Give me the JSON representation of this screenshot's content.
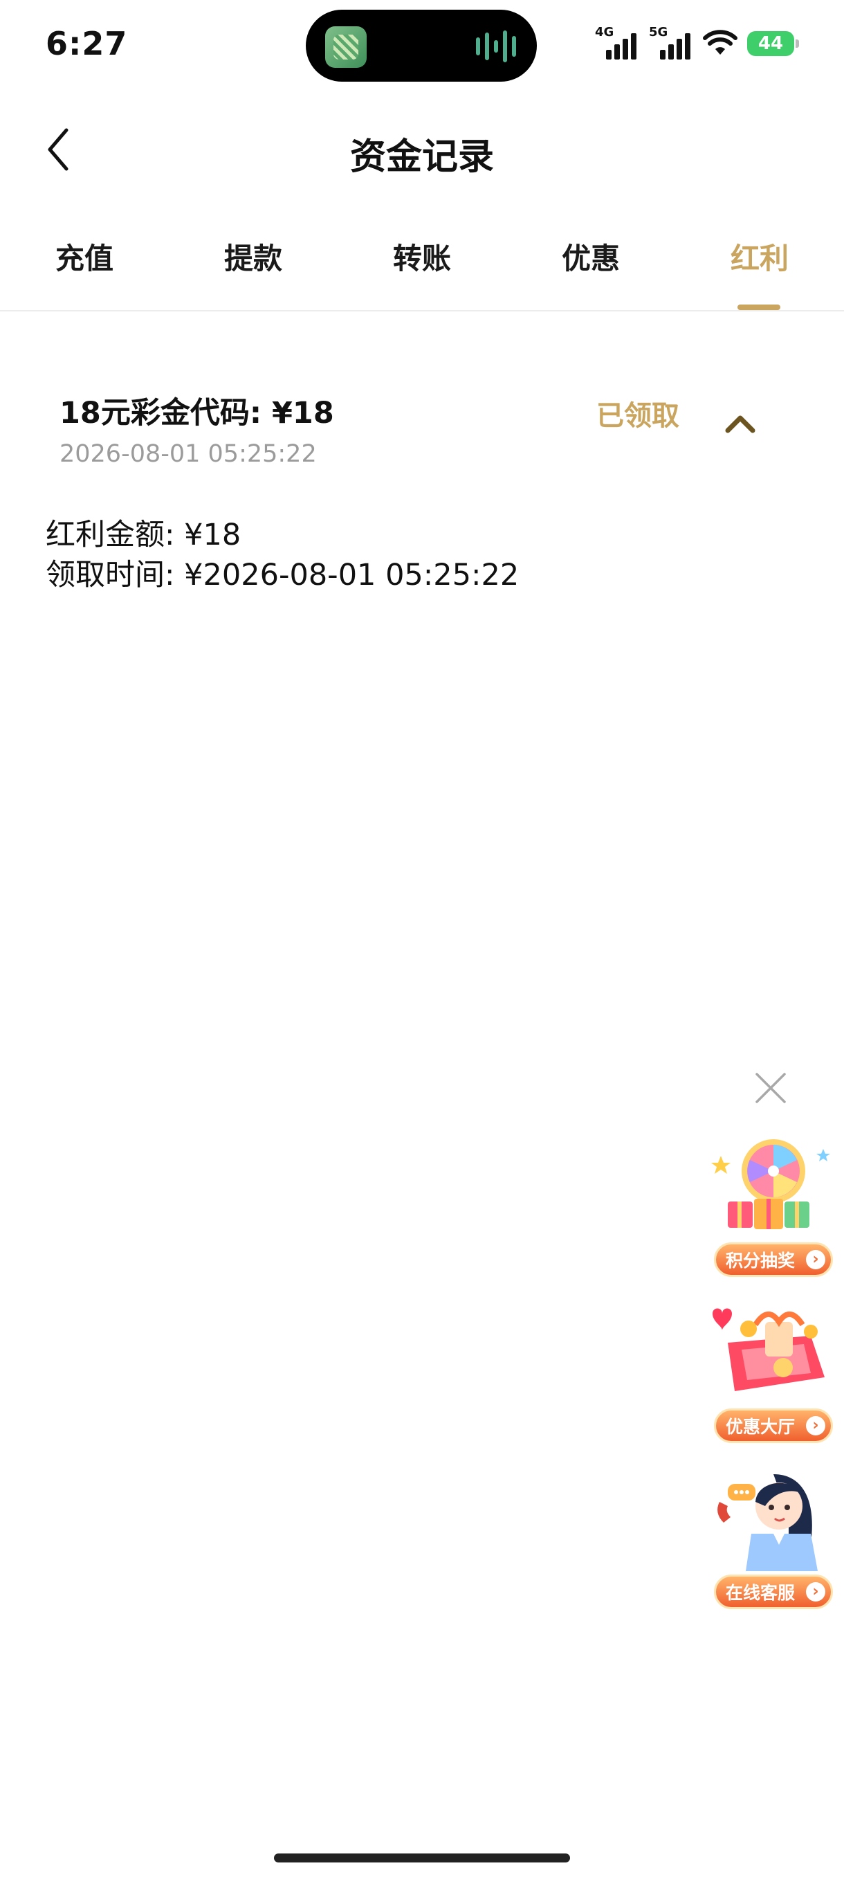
{
  "status_bar": {
    "time": "6:27",
    "network1": "4G",
    "network2": "5G",
    "battery": "44"
  },
  "header": {
    "title": "资金记录"
  },
  "tabs": [
    {
      "label": "充值"
    },
    {
      "label": "提款"
    },
    {
      "label": "转账"
    },
    {
      "label": "优惠"
    },
    {
      "label": "红利",
      "active": true
    }
  ],
  "record": {
    "title": "18元彩金代码: ¥18",
    "time": "2026-08-01 05:25:22",
    "status": "已领取",
    "details": {
      "amount_line": "红利金额: ¥18",
      "claim_time_line": "领取时间: ¥2026-08-01 05:25:22"
    }
  },
  "floating": {
    "promos": [
      {
        "label": "积分抽奖",
        "icon": "prize-wheel-icon"
      },
      {
        "label": "优惠大厅",
        "icon": "gift-box-icon"
      },
      {
        "label": "在线客服",
        "icon": "customer-service-icon"
      }
    ]
  },
  "colors": {
    "accent": "#c9a55f",
    "muted": "#9b9b9b"
  }
}
